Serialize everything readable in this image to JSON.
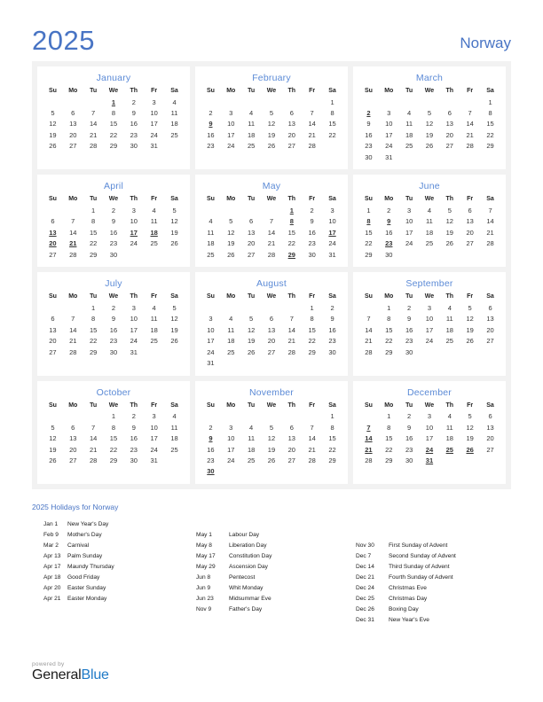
{
  "header": {
    "year": "2025",
    "country": "Norway",
    "year_color": "#4874c4",
    "country_color": "#4874c4"
  },
  "weekday_headers": [
    "Su",
    "Mo",
    "Tu",
    "We",
    "Th",
    "Fr",
    "Sa"
  ],
  "holiday_color": "#e00000",
  "month_name_color": "#5b8ad6",
  "months": [
    {
      "name": "January",
      "lead_blanks": 3,
      "days": 31,
      "holidays": [
        1
      ]
    },
    {
      "name": "February",
      "lead_blanks": 6,
      "days": 28,
      "holidays": [
        9
      ]
    },
    {
      "name": "March",
      "lead_blanks": 6,
      "days": 31,
      "holidays": [
        2
      ]
    },
    {
      "name": "April",
      "lead_blanks": 2,
      "days": 30,
      "holidays": [
        13,
        17,
        18,
        20,
        21
      ]
    },
    {
      "name": "May",
      "lead_blanks": 4,
      "days": 31,
      "holidays": [
        1,
        8,
        17,
        29
      ]
    },
    {
      "name": "June",
      "lead_blanks": 0,
      "days": 30,
      "holidays": [
        8,
        9,
        23
      ]
    },
    {
      "name": "July",
      "lead_blanks": 2,
      "days": 31,
      "holidays": []
    },
    {
      "name": "August",
      "lead_blanks": 5,
      "days": 31,
      "holidays": []
    },
    {
      "name": "September",
      "lead_blanks": 1,
      "days": 30,
      "holidays": []
    },
    {
      "name": "October",
      "lead_blanks": 3,
      "days": 31,
      "holidays": []
    },
    {
      "name": "November",
      "lead_blanks": 6,
      "days": 30,
      "holidays": [
        9,
        30
      ]
    },
    {
      "name": "December",
      "lead_blanks": 1,
      "days": 31,
      "holidays": [
        7,
        14,
        21,
        24,
        25,
        26,
        31
      ]
    }
  ],
  "holidays_section": {
    "title": "2025 Holidays for Norway",
    "columns": [
      [
        {
          "date": "Jan 1",
          "name": "New Year's Day"
        },
        {
          "date": "Feb 9",
          "name": "Mother's Day"
        },
        {
          "date": "Mar 2",
          "name": "Carnival"
        },
        {
          "date": "Apr 13",
          "name": "Palm Sunday"
        },
        {
          "date": "Apr 17",
          "name": "Maundy Thursday"
        },
        {
          "date": "Apr 18",
          "name": "Good Friday"
        },
        {
          "date": "Apr 20",
          "name": "Easter Sunday"
        },
        {
          "date": "Apr 21",
          "name": "Easter Monday"
        }
      ],
      [
        {
          "date": "May 1",
          "name": "Labour Day"
        },
        {
          "date": "May 8",
          "name": "Liberation Day"
        },
        {
          "date": "May 17",
          "name": "Constitution Day"
        },
        {
          "date": "May 29",
          "name": "Ascension Day"
        },
        {
          "date": "Jun 8",
          "name": "Pentecost"
        },
        {
          "date": "Jun 9",
          "name": "Whit Monday"
        },
        {
          "date": "Jun 23",
          "name": "Midsummar Eve"
        },
        {
          "date": "Nov 9",
          "name": "Father's Day"
        }
      ],
      [
        {
          "date": "Nov 30",
          "name": "First Sunday of Advent"
        },
        {
          "date": "Dec 7",
          "name": "Second Sunday of Advent"
        },
        {
          "date": "Dec 14",
          "name": "Third Sunday of Advent"
        },
        {
          "date": "Dec 21",
          "name": "Fourth Sunday of Advent"
        },
        {
          "date": "Dec 24",
          "name": "Christmas Eve"
        },
        {
          "date": "Dec 25",
          "name": "Christmas Day"
        },
        {
          "date": "Dec 26",
          "name": "Boxing Day"
        },
        {
          "date": "Dec 31",
          "name": "New Year's Eve"
        }
      ]
    ],
    "column_offsets": [
      0,
      1,
      2
    ]
  },
  "footer": {
    "powered_by": "powered by",
    "brand_first": "General",
    "brand_second": "Blue",
    "brand_second_color": "#1f7ac7"
  }
}
